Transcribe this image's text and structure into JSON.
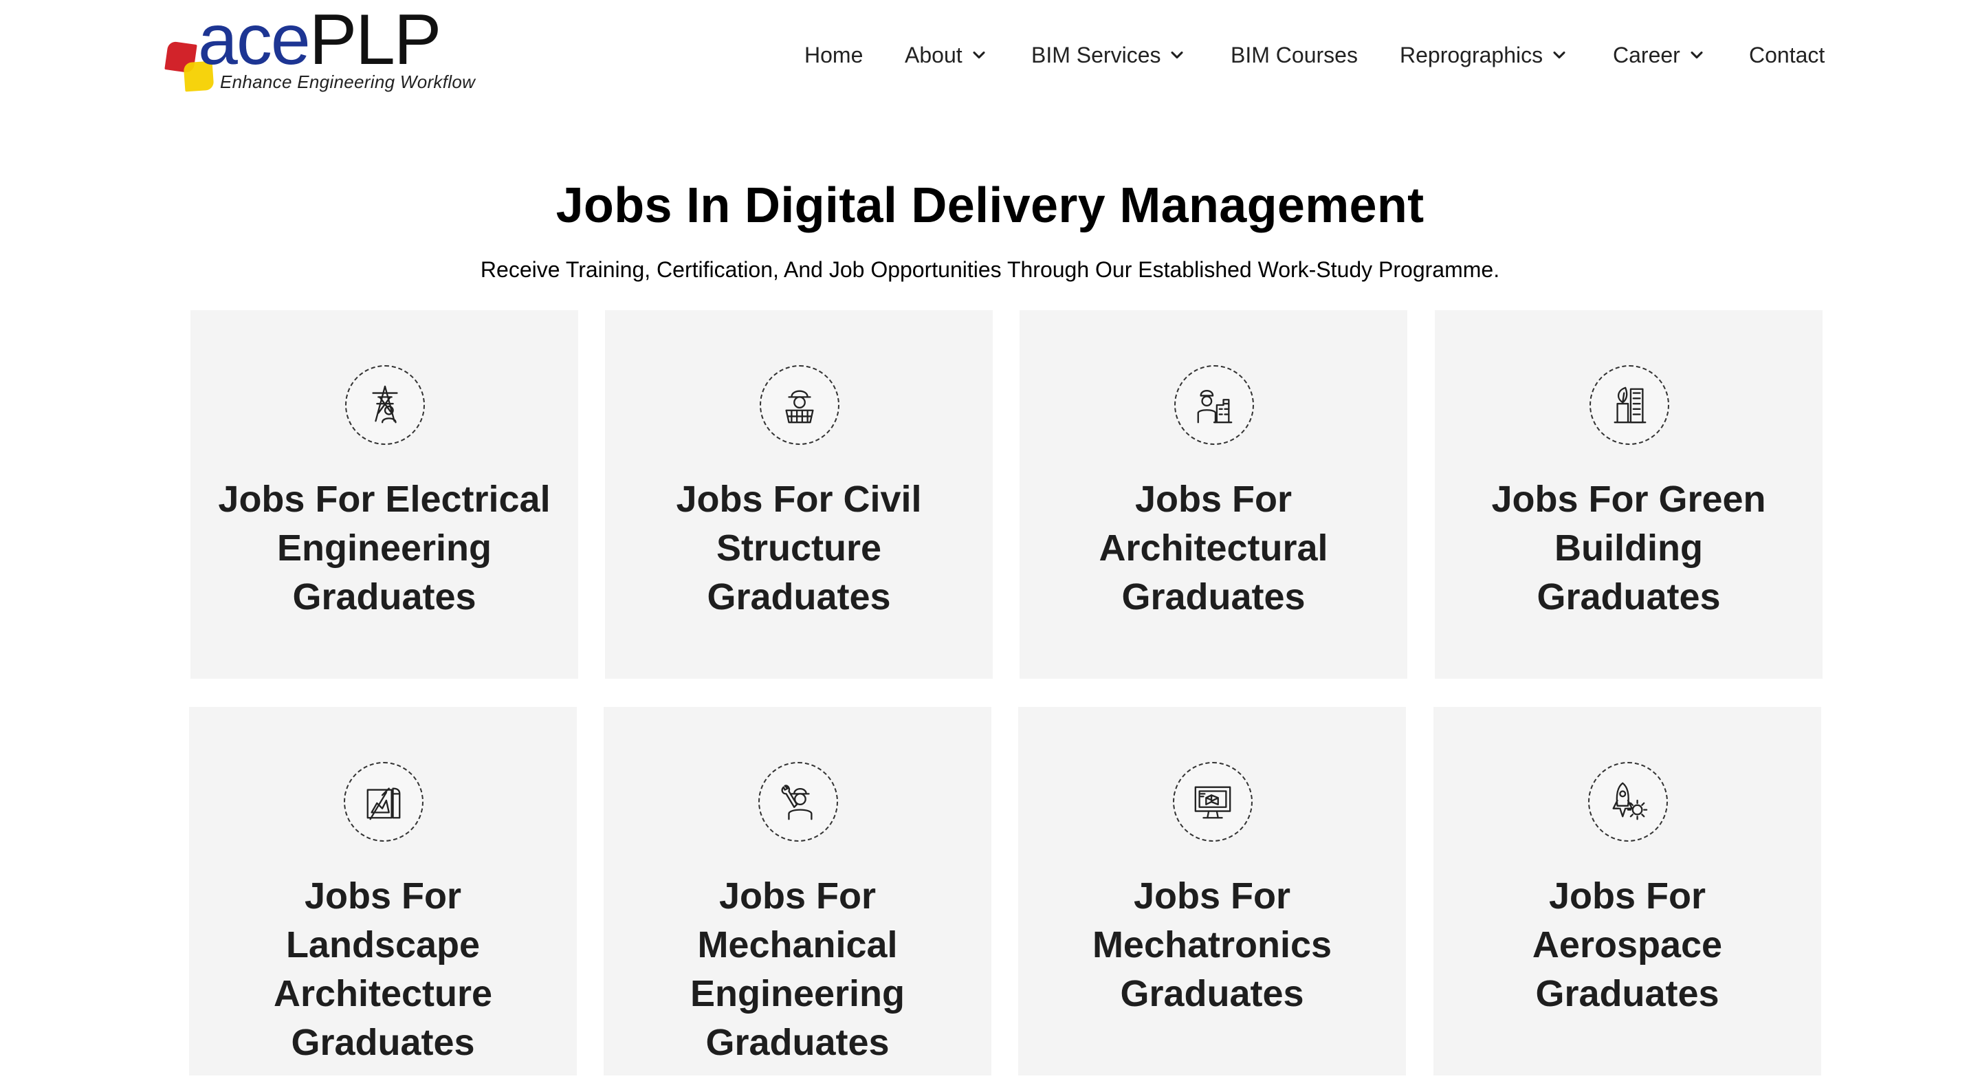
{
  "brand": {
    "logo_lower": "ace",
    "logo_upper": "PLP",
    "tagline": "Enhance Engineering Workflow"
  },
  "nav": {
    "items": [
      {
        "label": "Home",
        "dropdown": false
      },
      {
        "label": "About",
        "dropdown": true
      },
      {
        "label": "BIM Services",
        "dropdown": true
      },
      {
        "label": "BIM Courses",
        "dropdown": false
      },
      {
        "label": "Reprographics",
        "dropdown": true
      },
      {
        "label": "Career",
        "dropdown": true
      },
      {
        "label": "Contact",
        "dropdown": false
      }
    ]
  },
  "hero": {
    "title": "Jobs In Digital Delivery Management",
    "subtitle": "Receive Training, Certification, And Job Opportunities Through Our Established Work-Study Programme."
  },
  "cards": [
    {
      "icon": "electrical-tower-worker-icon",
      "lines": [
        "Jobs For Electrical",
        "Engineering",
        "Graduates"
      ]
    },
    {
      "icon": "civil-engineer-helmet-icon",
      "lines": [
        "Jobs For Civil",
        "Structure",
        "Graduates"
      ]
    },
    {
      "icon": "architect-buildings-icon",
      "lines": [
        "Jobs For",
        "Architectural",
        "Graduates"
      ]
    },
    {
      "icon": "green-building-icon",
      "lines": [
        "Jobs For Green",
        "Building",
        "Graduates"
      ]
    },
    {
      "icon": "landscape-blueprint-icon",
      "lines": [
        "Jobs For Landscape",
        "Architecture",
        "Graduates"
      ]
    },
    {
      "icon": "mechanic-wrench-icon",
      "lines": [
        "Jobs For Mechanical",
        "Engineering",
        "Graduates"
      ]
    },
    {
      "icon": "mechatronics-monitor-icon",
      "lines": [
        "Jobs For",
        "Mechatronics",
        "Graduates"
      ]
    },
    {
      "icon": "aerospace-rocket-gear-icon",
      "lines": [
        "Jobs For",
        "Aerospace",
        "Graduates"
      ]
    }
  ],
  "colors": {
    "brand_blue": "#1d3593",
    "brand_red": "#d2232a",
    "brand_yellow": "#f5d100",
    "card_bg": "#f4f4f4"
  }
}
